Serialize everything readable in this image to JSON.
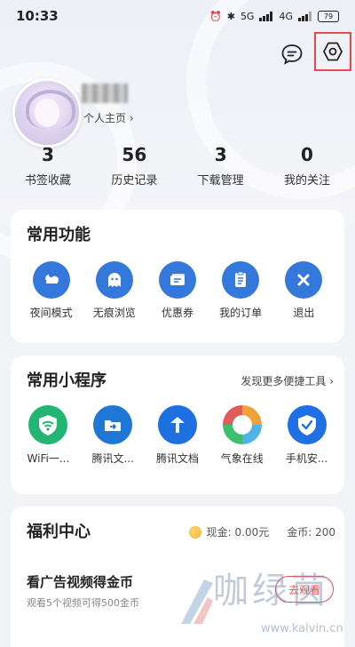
{
  "status_bar": {
    "time": "10:33",
    "network": "5G",
    "wifi": "4G",
    "battery": "79"
  },
  "profile": {
    "link_label": "个人主页 ›"
  },
  "stats": [
    {
      "value": "3",
      "label": "书签收藏"
    },
    {
      "value": "56",
      "label": "历史记录"
    },
    {
      "value": "3",
      "label": "下载管理"
    },
    {
      "value": "0",
      "label": "我的关注"
    }
  ],
  "common_functions": {
    "title": "常用功能",
    "items": [
      {
        "label": "夜间模式",
        "icon": "night-mode-icon"
      },
      {
        "label": "无痕浏览",
        "icon": "ghost-icon"
      },
      {
        "label": "优惠券",
        "icon": "coupon-icon"
      },
      {
        "label": "我的订单",
        "icon": "order-icon"
      },
      {
        "label": "退出",
        "icon": "exit-icon"
      }
    ]
  },
  "mini_programs": {
    "title": "常用小程序",
    "more_label": "发现更多便捷工具 ›",
    "items": [
      {
        "label": "WiFi一...",
        "icon": "wifi-shield-icon",
        "color": "#22b573"
      },
      {
        "label": "腾讯文...",
        "icon": "folder-icon",
        "color": "#1f78d6"
      },
      {
        "label": "腾讯文档",
        "icon": "tencent-docs-icon",
        "color": "#1e6fe0"
      },
      {
        "label": "气象在线",
        "icon": "weather-icon",
        "color": "#f0a23a"
      },
      {
        "label": "手机安...",
        "icon": "phone-security-icon",
        "color": "#1f6fe5"
      }
    ]
  },
  "welfare": {
    "title": "福利中心",
    "cash": "现金: 0.00元",
    "coins": "金币: 200",
    "task_title": "看广告视频得金币",
    "task_desc": "观看5个视频可得500金币",
    "task_button": "去观看"
  },
  "watermark": {
    "text": "咖绿茵",
    "url": "www.kalvin.cn"
  },
  "colors": {
    "accent": "#3478db",
    "highlight": "#e84a4a"
  }
}
